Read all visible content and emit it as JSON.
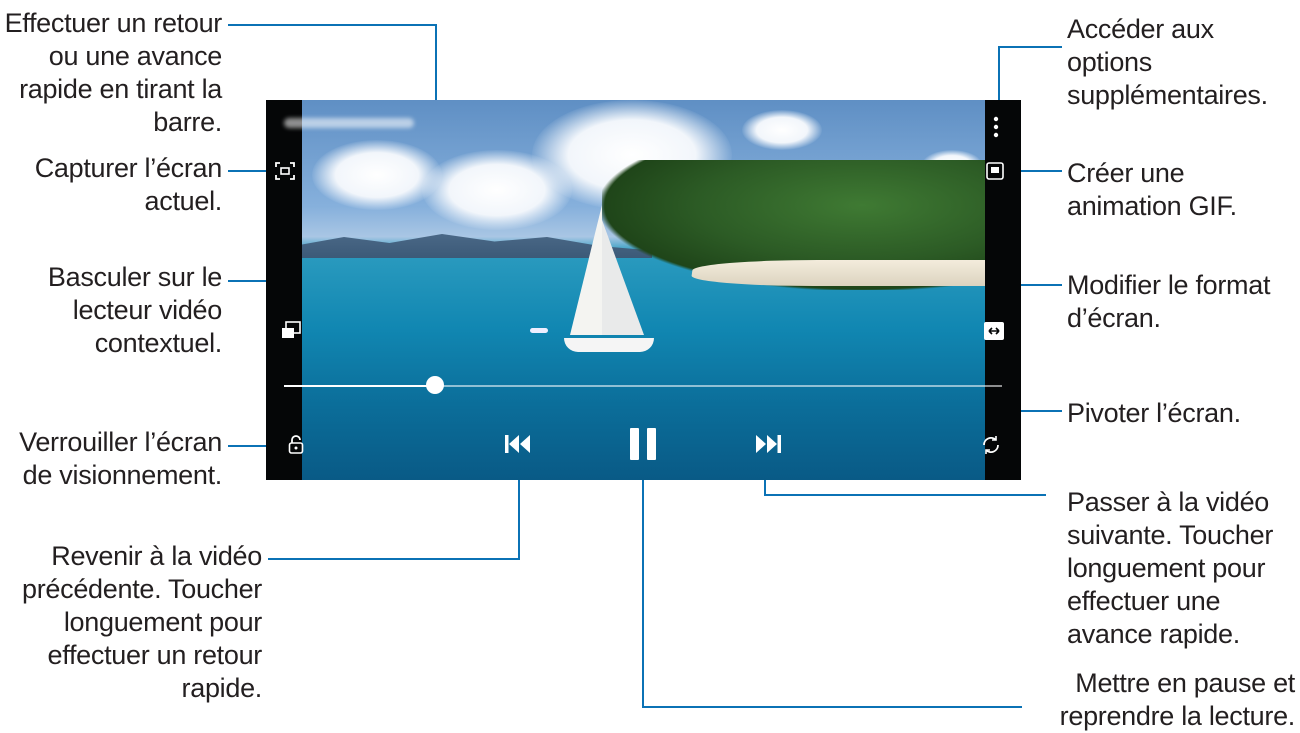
{
  "callouts": {
    "seek": "Effectuer un retour ou une avance rapide en tirant la barre.",
    "capture": "Capturer l’écran actuel.",
    "popup": "Basculer sur le lecteur vidéo contextuel.",
    "lock": "Verrouiller l’écran de visionnement.",
    "previous": "Revenir à la vidéo précédente. Toucher longuement pour effectuer un retour rapide.",
    "more": "Accéder aux options supplémentaires.",
    "gif": "Créer une animation GIF.",
    "ratio": "Modifier le format d’écran.",
    "rotate": "Pivoter l’écran.",
    "next": "Passer à la vidéo suivante. Toucher longuement pour effectuer une avance rapide.",
    "pause": "Mettre en pause et reprendre la lecture."
  },
  "player": {
    "state": "playing",
    "progress_fraction": 0.21,
    "icons": [
      "capture-icon",
      "popup-player-icon",
      "lock-icon",
      "more-options-icon",
      "gif-icon",
      "screen-ratio-icon",
      "rotate-icon",
      "previous-icon",
      "pause-icon",
      "next-icon"
    ]
  },
  "colors": {
    "leader_line": "#0b72b5",
    "text": "#231f20",
    "frame": "#050607"
  }
}
